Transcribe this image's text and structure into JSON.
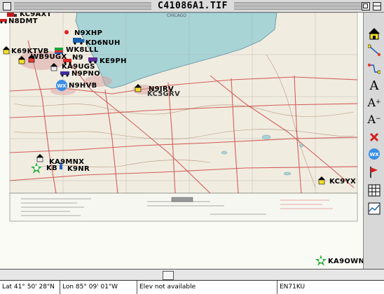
{
  "window": {
    "title": "C41086A1.TIF"
  },
  "map": {
    "lake_label": "CHICAGO",
    "callsigns": [
      {
        "text": "KC9AXT",
        "icon": "truck-icon"
      },
      {
        "text": "N8DMT",
        "icon": "car-icon"
      },
      {
        "text": "N9XHP",
        "icon": "dot-icon"
      },
      {
        "text": "KD6NUH",
        "icon": "truck-icon"
      },
      {
        "text": "K69KTVB",
        "icon": "house-icon"
      },
      {
        "text": "WK8LLL",
        "icon": "car-icon"
      },
      {
        "text": "WB9UGX",
        "icon": "house-icon"
      },
      {
        "text": "N9",
        "icon": "house-icon"
      },
      {
        "text": "KE9PH",
        "icon": "car-icon"
      },
      {
        "text": "KA9UGS",
        "icon": "house-icon"
      },
      {
        "text": "N9PNO",
        "icon": "car-icon"
      },
      {
        "text": "N9HVB",
        "icon": "wx-icon"
      },
      {
        "text": "N9JRV",
        "icon": "house-icon"
      },
      {
        "text": "KC5GRV",
        "icon": "house-icon"
      },
      {
        "text": "KA9MNX",
        "icon": "house-icon"
      },
      {
        "text": "KB",
        "icon": "star-icon"
      },
      {
        "text": "K9NR",
        "icon": "person-icon"
      },
      {
        "text": "KC9YX",
        "icon": "house-icon"
      },
      {
        "text": "KA9OWN",
        "icon": "star-icon"
      }
    ]
  },
  "toolbar": {
    "tools": [
      {
        "name": "home-tool",
        "icon": "house-icon"
      },
      {
        "name": "route-tool",
        "icon": "path-icon"
      },
      {
        "name": "route-alt-tool",
        "icon": "path-icon"
      },
      {
        "name": "text-tool",
        "glyph": "A"
      },
      {
        "name": "text-larger-tool",
        "glyph": "A+"
      },
      {
        "name": "text-smaller-tool",
        "glyph": "A-"
      },
      {
        "name": "delete-tool",
        "icon": "x-icon"
      },
      {
        "name": "weather-tool",
        "icon": "wx-icon"
      },
      {
        "name": "flag-tool",
        "icon": "flag-icon"
      },
      {
        "name": "grid-tool",
        "icon": "grid-icon"
      },
      {
        "name": "graph-tool",
        "icon": "graph-icon"
      }
    ]
  },
  "status": {
    "lat": "Lat  41° 50' 28\"N",
    "lon": "Lon  85° 09' 01\"W",
    "elev": "Elev not available",
    "grid": "EN71KU"
  },
  "colors": {
    "lake": "#a9d4d6",
    "roads": "#c8302e",
    "chrome": "#dcdcdc"
  }
}
